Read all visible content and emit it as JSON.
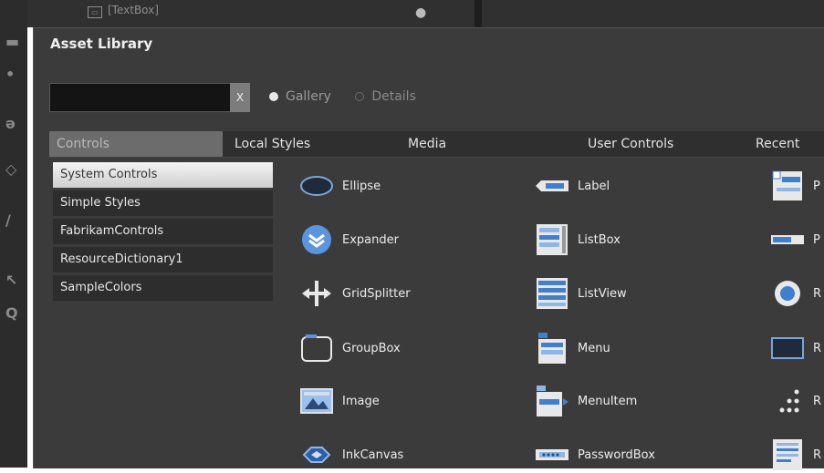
{
  "background": {
    "panel_item": "[TextBox]"
  },
  "dialog": {
    "title": "Asset Library",
    "search": {
      "value": "",
      "clear_label": "X"
    },
    "view_options": [
      {
        "label": "Gallery",
        "checked": true
      },
      {
        "label": "Details",
        "checked": false
      }
    ],
    "tabs": [
      "Controls",
      "Local Styles",
      "Media",
      "User Controls",
      "Recent"
    ],
    "active_tab": "Controls",
    "categories": [
      {
        "label": "System Controls",
        "selected": true
      },
      {
        "label": "Simple Styles",
        "selected": false
      },
      {
        "label": "FabrikamControls",
        "selected": false
      },
      {
        "label": "ResourceDictionary1",
        "selected": false
      },
      {
        "label": "SampleColors",
        "selected": false
      }
    ],
    "controls": {
      "col1": [
        {
          "label": "Ellipse",
          "icon": "ellipse-icon"
        },
        {
          "label": "Expander",
          "icon": "expander-icon"
        },
        {
          "label": "GridSplitter",
          "icon": "gridsplitter-icon"
        },
        {
          "label": "GroupBox",
          "icon": "groupbox-icon"
        },
        {
          "label": "Image",
          "icon": "image-icon"
        },
        {
          "label": "InkCanvas",
          "icon": "inkcanvas-icon"
        }
      ],
      "col2": [
        {
          "label": "Label",
          "icon": "label-icon"
        },
        {
          "label": "ListBox",
          "icon": "listbox-icon"
        },
        {
          "label": "ListView",
          "icon": "listview-icon"
        },
        {
          "label": "Menu",
          "icon": "menu-icon"
        },
        {
          "label": "MenuItem",
          "icon": "menuitem-icon"
        },
        {
          "label": "PasswordBox",
          "icon": "passwordbox-icon"
        }
      ],
      "col3": [
        {
          "label": "P",
          "icon": "page-icon"
        },
        {
          "label": "P",
          "icon": "progressbar-icon"
        },
        {
          "label": "R",
          "icon": "radiobutton-icon"
        },
        {
          "label": "R",
          "icon": "rectangle-icon"
        },
        {
          "label": "R",
          "icon": "repeatbutton-icon"
        },
        {
          "label": "R",
          "icon": "richtextbox-icon"
        }
      ]
    }
  },
  "colors": {
    "dialog_bg": "#3b3b3b",
    "tab_bar": "#2f2f2f",
    "active_tab": "#6c6c6c",
    "icon_blue": "#3f7fd0",
    "icon_light_blue": "#8fb6e8"
  }
}
